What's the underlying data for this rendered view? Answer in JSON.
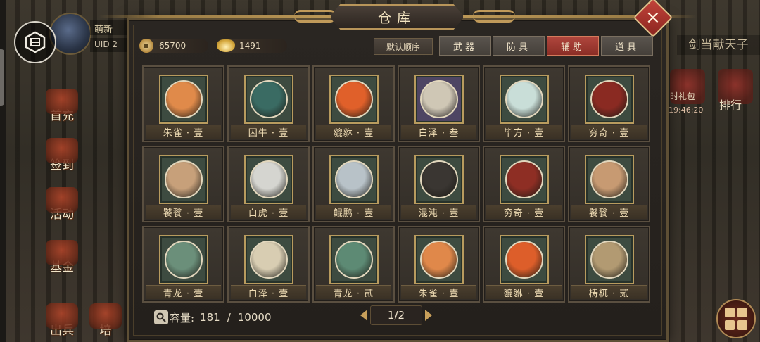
{
  "player": {
    "name": "萌新",
    "uid": "UID 2"
  },
  "side_menu": [
    {
      "label": "首充"
    },
    {
      "label": "签到"
    },
    {
      "label": "活动"
    },
    {
      "label": "基金"
    },
    {
      "label": "出兵"
    },
    {
      "label": "培"
    }
  ],
  "right_hud": {
    "banner": "剑当献天子",
    "gift_label": "时礼包",
    "timer": "19:46:20",
    "rank_label": "排行"
  },
  "panel": {
    "title": "仓库",
    "close_icon": "close-icon"
  },
  "currency": {
    "copper": "65700",
    "gold": "1491"
  },
  "sort_button": "默认顺序",
  "tabs": [
    {
      "label": "武器",
      "active": false
    },
    {
      "label": "防具",
      "active": false
    },
    {
      "label": "辅助",
      "active": true
    },
    {
      "label": "道具",
      "active": false
    }
  ],
  "items": [
    {
      "name": "朱雀 · 壹",
      "color": "#e08a4a",
      "frame": "green"
    },
    {
      "name": "囚牛 · 壹",
      "color": "#3a6b63",
      "frame": "green"
    },
    {
      "name": "貔貅 · 壹",
      "color": "#e0602a",
      "frame": "green"
    },
    {
      "name": "白泽 · 叁",
      "color": "#cfc7b5",
      "frame": "purple"
    },
    {
      "name": "毕方 · 壹",
      "color": "#c9ded8",
      "frame": "green"
    },
    {
      "name": "穷奇 · 壹",
      "color": "#8a2a22",
      "frame": "green"
    },
    {
      "name": "饕餮 · 壹",
      "color": "#c7a07a",
      "frame": "green"
    },
    {
      "name": "白虎 · 壹",
      "color": "#d5d5d0",
      "frame": "green"
    },
    {
      "name": "鲲鹏 · 壹",
      "color": "#b8c2c8",
      "frame": "green"
    },
    {
      "name": "混沌 · 壹",
      "color": "#3a3632",
      "frame": "green"
    },
    {
      "name": "穷奇 · 壹",
      "color": "#8e2e24",
      "frame": "green"
    },
    {
      "name": "饕餮 · 壹",
      "color": "#c79a72",
      "frame": "green"
    },
    {
      "name": "青龙 · 壹",
      "color": "#6b8f7a",
      "frame": "green"
    },
    {
      "name": "白泽 · 壹",
      "color": "#d8cdb2",
      "frame": "green"
    },
    {
      "name": "青龙 · 贰",
      "color": "#5d8a74",
      "frame": "green"
    },
    {
      "name": "朱雀 · 壹",
      "color": "#e0884a",
      "frame": "green"
    },
    {
      "name": "貔貅 · 壹",
      "color": "#dd5e2a",
      "frame": "green"
    },
    {
      "name": "梼杌 · 贰",
      "color": "#b29a72",
      "frame": "green"
    }
  ],
  "footer": {
    "capacity_label": "容量:",
    "capacity_used": "181",
    "capacity_sep": "/",
    "capacity_max": "10000",
    "page": "1/2"
  }
}
